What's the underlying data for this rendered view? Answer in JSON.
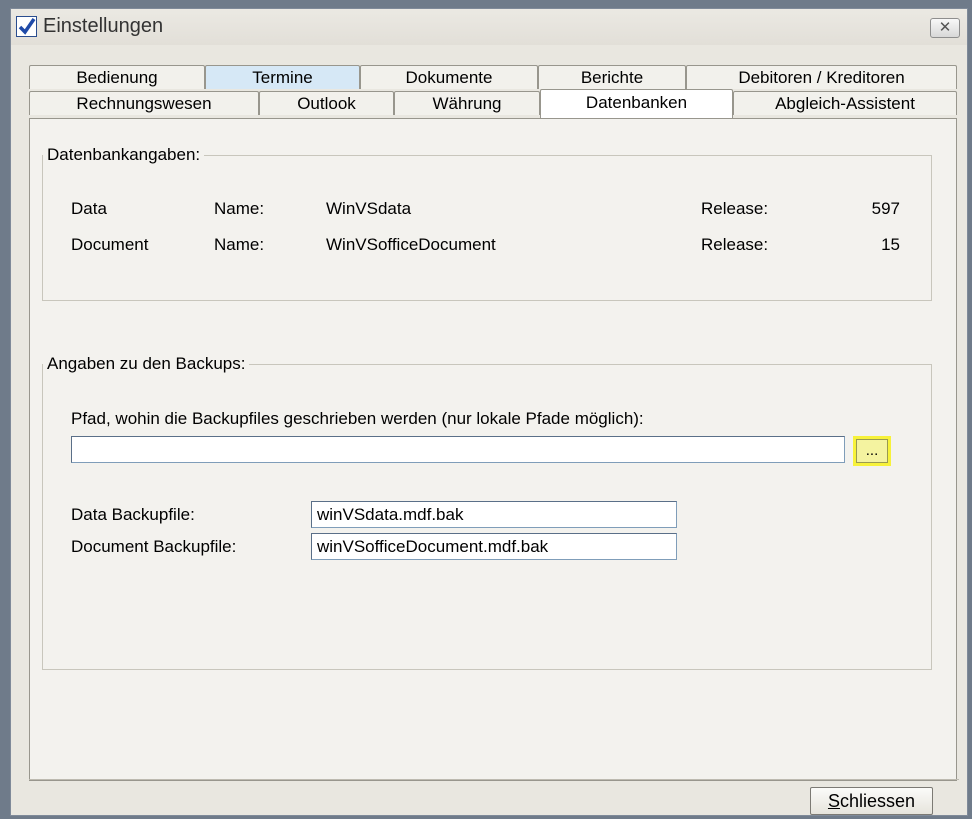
{
  "window": {
    "title": "Einstellungen",
    "close_symbol": "✕"
  },
  "tabs_row1": [
    {
      "label": "Bedienung"
    },
    {
      "label": "Termine"
    },
    {
      "label": "Dokumente"
    },
    {
      "label": "Berichte"
    },
    {
      "label": "Debitoren / Kreditoren"
    }
  ],
  "tabs_row2": [
    {
      "label": "Rechnungswesen"
    },
    {
      "label": "Outlook"
    },
    {
      "label": "Währung"
    },
    {
      "label": "Datenbanken"
    },
    {
      "label": "Abgleich-Assistent"
    }
  ],
  "databases": {
    "legend": "Datenbankangaben:",
    "rows": [
      {
        "kind": "Data",
        "name_label": "Name:",
        "name": "WinVSdata",
        "release_label": "Release:",
        "release": "597"
      },
      {
        "kind": "Document",
        "name_label": "Name:",
        "name": "WinVSofficeDocument",
        "release_label": "Release:",
        "release": "15"
      }
    ]
  },
  "backups": {
    "legend": "Angaben zu den Backups:",
    "path_label": "Pfad, wohin die Backupfiles geschrieben werden (nur lokale Pfade möglich):",
    "path_value": "",
    "browse_label": "...",
    "data_label": "Data Backupfile:",
    "data_value": "winVSdata.mdf.bak",
    "document_label": "Document Backupfile:",
    "document_value": "winVSofficeDocument.mdf.bak"
  },
  "footer": {
    "close_first": "S",
    "close_rest": "chliessen"
  },
  "colors": {
    "highlight": "#f7f23a",
    "active_tab": "#ffffff",
    "hover_tab": "#d6e8f6"
  }
}
